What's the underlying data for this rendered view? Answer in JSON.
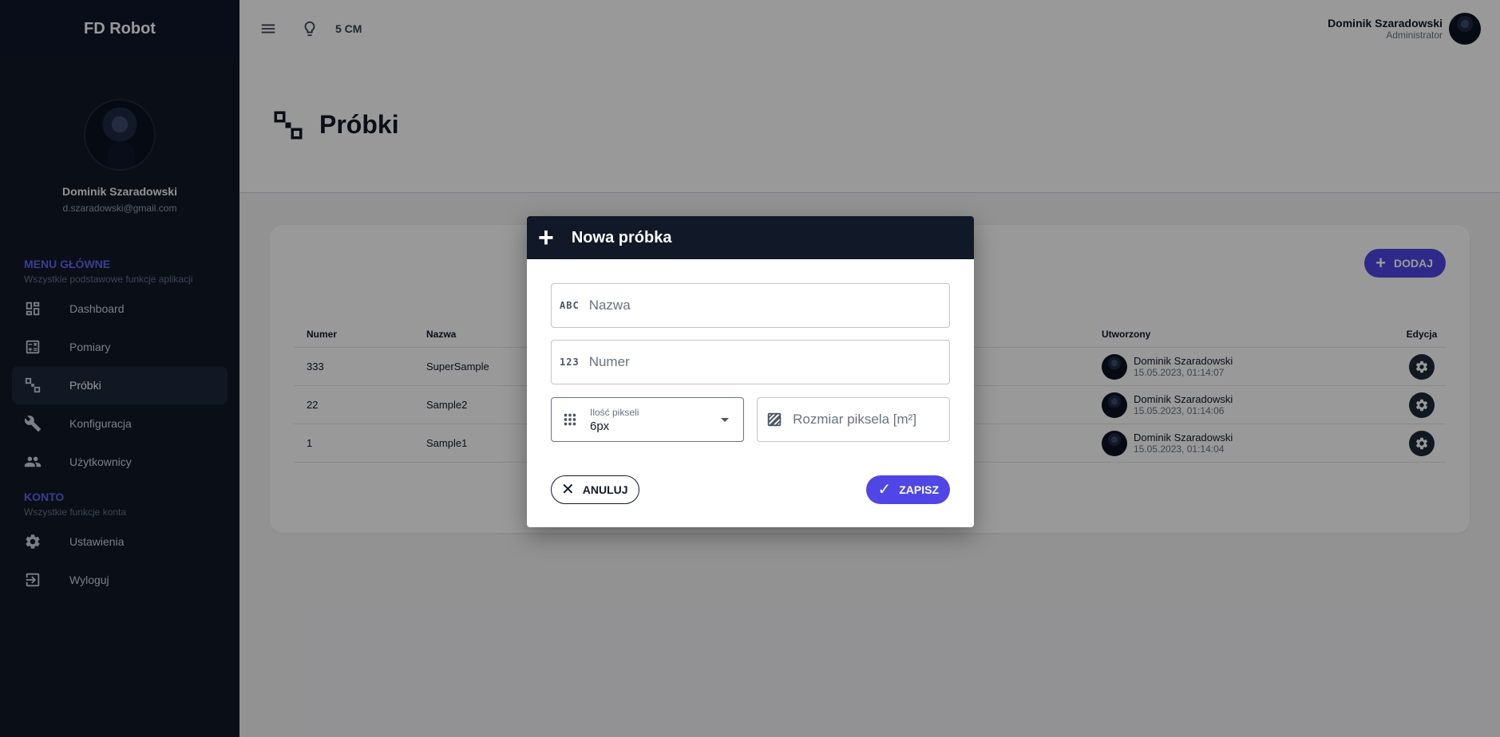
{
  "app": {
    "brand": "FD Robot"
  },
  "sidebar": {
    "profile": {
      "name": "Dominik Szaradowski",
      "email": "d.szaradowski@gmail.com"
    },
    "main_section": {
      "title": "MENU GŁÓWNE",
      "subtitle": "Wszystkie podstawowe funkcje aplikacji"
    },
    "items": [
      {
        "label": "Dashboard",
        "icon": "dashboard-icon"
      },
      {
        "label": "Pomiary",
        "icon": "calculator-icon"
      },
      {
        "label": "Próbki",
        "icon": "samples-icon",
        "active": true
      },
      {
        "label": "Konfiguracja",
        "icon": "wrench-icon"
      },
      {
        "label": "Użytkownicy",
        "icon": "users-icon"
      }
    ],
    "account_section": {
      "title": "KONTO",
      "subtitle": "Wszystkie funkcje konta"
    },
    "account_items": [
      {
        "label": "Ustawienia",
        "icon": "gear-icon"
      },
      {
        "label": "Wyloguj",
        "icon": "logout-icon"
      }
    ]
  },
  "topbar": {
    "status_text": "5 CM",
    "user_name": "Dominik Szaradowski",
    "user_role": "Administrator"
  },
  "page": {
    "title": "Próbki"
  },
  "card": {
    "add_label": "DODAJ",
    "columns": {
      "number": "Numer",
      "name": "Nazwa",
      "created": "Utworzony",
      "edit": "Edycja"
    },
    "rows": [
      {
        "number": "333",
        "name": "SuperSample",
        "creator": "Dominik Szaradowski",
        "date": "15.05.2023, 01:14:07"
      },
      {
        "number": "22",
        "name": "Sample2",
        "creator": "Dominik Szaradowski",
        "date": "15.05.2023, 01:14:06"
      },
      {
        "number": "1",
        "name": "Sample1",
        "creator": "Dominik Szaradowski",
        "date": "15.05.2023, 01:14:04"
      }
    ]
  },
  "dialog": {
    "title": "Nowa próbka",
    "name_placeholder": "Nazwa",
    "name_icon_text": "ABC",
    "number_placeholder": "Numer",
    "number_icon_text": "123",
    "pixels_label": "Ilość pikseli",
    "pixels_value": "6px",
    "pixel_size_placeholder": "Rozmiar piksela [m²]",
    "cancel_label": "ANULUJ",
    "save_label": "ZAPISZ"
  },
  "colors": {
    "sidebar_bg": "#111827",
    "accent": "#4f46e5",
    "section_title": "#6366f1"
  }
}
